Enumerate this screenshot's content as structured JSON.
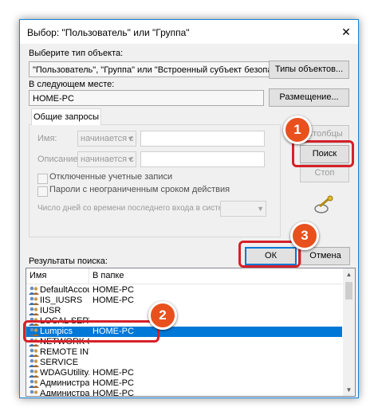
{
  "window": {
    "title": "Выбор: \"Пользователь\" или \"Группа\"",
    "close_glyph": "✕"
  },
  "object_type": {
    "label": "Выберите тип объекта:",
    "value": "\"Пользователь\", \"Группа\" или \"Встроенный субъект безопасности\"",
    "button": "Типы объектов..."
  },
  "location": {
    "label": "В следующем месте:",
    "value": "HOME-PC",
    "button": "Размещение..."
  },
  "common_queries": {
    "tab": "Общие запросы",
    "name_label": "Имя:",
    "name_mode": "начинается с",
    "description_label": "Описание:",
    "description_mode": "начинается с",
    "disabled_accounts": "Отключенные учетные записи",
    "no_expire_passwords": "Пароли с неограниченным сроком действия",
    "days_since_login": "Число дней со времени последнего входа в систему:"
  },
  "side_buttons": {
    "columns": "Столбцы",
    "search": "Поиск",
    "stop": "Стоп"
  },
  "dialog_buttons": {
    "ok": "ОК",
    "cancel": "Отмена"
  },
  "results": {
    "label": "Результаты поиска:",
    "col_name": "Имя",
    "col_folder": "В папке",
    "rows": [
      {
        "name": "DefaultAccount",
        "folder": "HOME-PC"
      },
      {
        "name": "IIS_IUSRS",
        "folder": "HOME-PC"
      },
      {
        "name": "IUSR",
        "folder": ""
      },
      {
        "name": "LOCAL SERVICE",
        "folder": ""
      },
      {
        "name": "Lumpics",
        "folder": "HOME-PC"
      },
      {
        "name": "NETWORK SERVICE",
        "folder": ""
      },
      {
        "name": "REMOTE INTERACTIVE",
        "folder": ""
      },
      {
        "name": "SERVICE",
        "folder": ""
      },
      {
        "name": "WDAGUtilityAccount",
        "folder": "HOME-PC"
      },
      {
        "name": "Администраторы",
        "folder": "HOME-PC"
      },
      {
        "name": "Администратор",
        "folder": "HOME-PC"
      }
    ]
  },
  "annotations": {
    "step1": "1",
    "step2": "2",
    "step3": "3"
  },
  "colors": {
    "accent": "#0078d7",
    "badge": "#e8501e",
    "highlight": "#d6212a"
  }
}
